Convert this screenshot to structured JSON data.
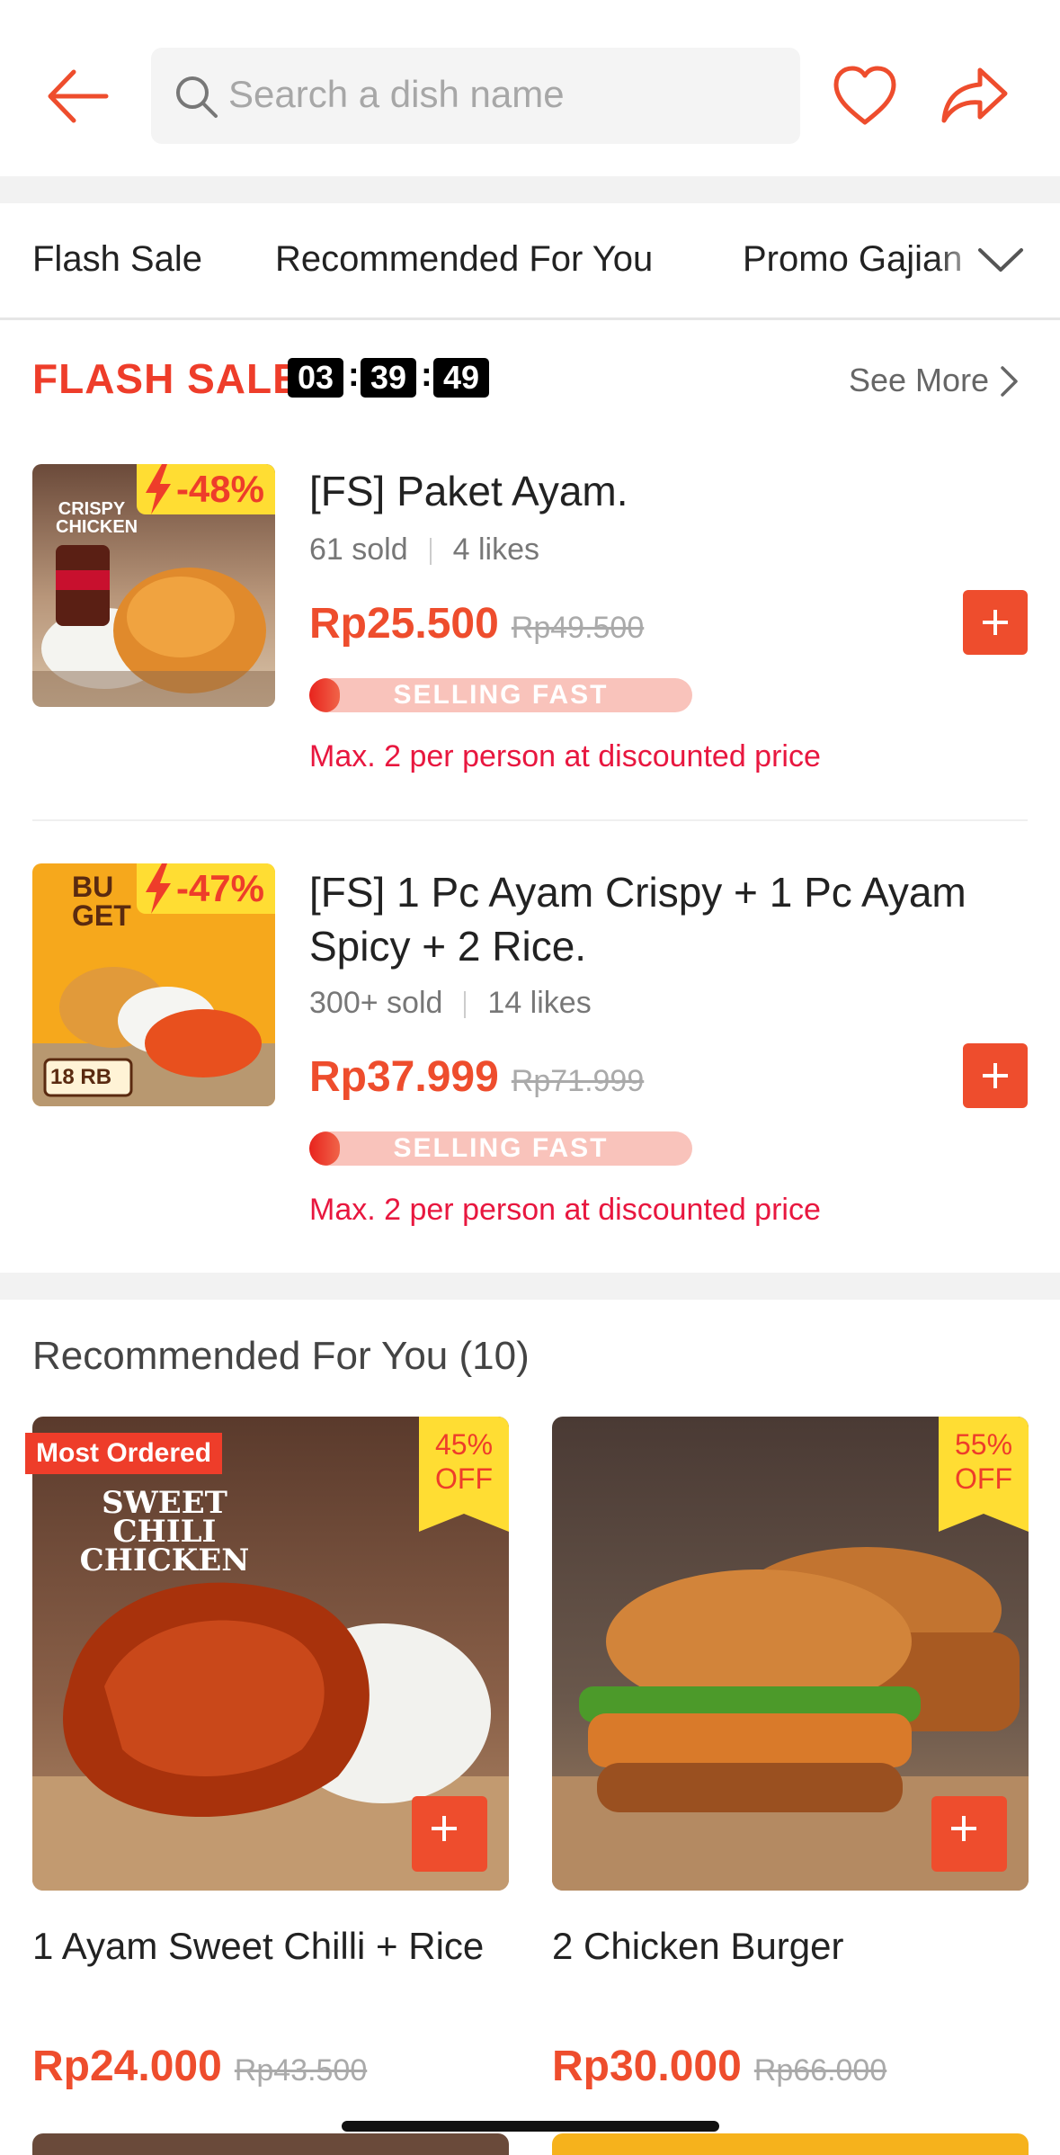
{
  "header": {
    "search_placeholder": "Search a dish name"
  },
  "tabs": [
    "Flash Sale",
    "Recommended For You",
    "Promo Gajian"
  ],
  "flash_sale": {
    "title": "FLASH SALE",
    "timer": {
      "h": "03",
      "m": "39",
      "s": "49"
    },
    "see_more": "See More",
    "items": [
      {
        "name": "[FS] Paket Ayam.",
        "sold": "61 sold",
        "likes": "4 likes",
        "price": "Rp25.500",
        "old_price": "Rp49.500",
        "discount": "-48%",
        "status": "SELLING FAST",
        "progress": 0.08,
        "limit": "Max. 2 per person at discounted price",
        "image_text": "CRISPY CHICKEN"
      },
      {
        "name": "[FS] 1 Pc Ayam Crispy + 1 Pc Ayam Spicy + 2 Rice.",
        "sold": "300+ sold",
        "likes": "14 likes",
        "price": "Rp37.999",
        "old_price": "Rp71.999",
        "discount": "-47%",
        "status": "SELLING FAST",
        "progress": 0.08,
        "limit": "Max. 2 per person at discounted price",
        "image_text": "BU GET",
        "image_badge": "18 RB"
      }
    ]
  },
  "recommended": {
    "title": "Recommended For You (10)",
    "items": [
      {
        "name": "1 Ayam Sweet Chilli + Rice",
        "price": "Rp24.000",
        "old_price": "Rp43.500",
        "discount_pct": "45%",
        "discount_word": "OFF",
        "badge": "Most Ordered",
        "image_text": "SWEET CHILI CHICKEN"
      },
      {
        "name": "2 Chicken Burger",
        "price": "Rp30.000",
        "old_price": "Rp66.000",
        "discount_pct": "55%",
        "discount_word": "OFF"
      }
    ]
  },
  "colors": {
    "accent": "#ee4d2d",
    "flash_red": "#ee3d2a",
    "tag_yellow": "#ffdd33",
    "limit_text": "#e8173f"
  }
}
